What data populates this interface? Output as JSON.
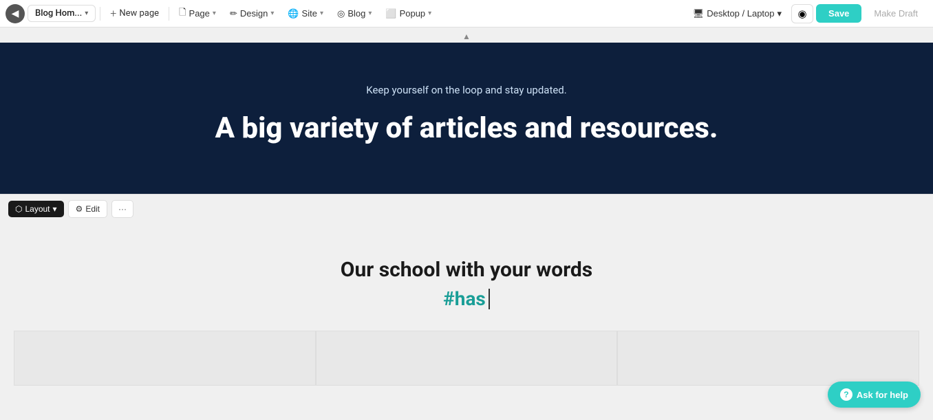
{
  "toolbar": {
    "back_icon": "◀",
    "page_name": "Blog Hom...",
    "page_chevron": "▾",
    "new_page_icon": "+",
    "new_page_label": "New page",
    "page_menu": {
      "icon": "🗋",
      "label": "Page",
      "chevron": "▾"
    },
    "design_menu": {
      "icon": "✏",
      "label": "Design",
      "chevron": "▾"
    },
    "site_menu": {
      "icon": "🌐",
      "label": "Site",
      "chevron": "▾"
    },
    "blog_menu": {
      "icon": "◎",
      "label": "Blog",
      "chevron": "▾"
    },
    "popup_menu": {
      "icon": "⬜",
      "label": "Popup",
      "chevron": "▾"
    },
    "preview_label": "Desktop / Laptop",
    "preview_chevron": "▾",
    "preview_icon": "🖥",
    "eye_icon": "◉",
    "save_label": "Save",
    "draft_label": "Make Draft"
  },
  "section_controls": {
    "layout_label": "Layout",
    "layout_icon": "⬡",
    "layout_chevron": "▾",
    "edit_icon": "⚙",
    "edit_label": "Edit",
    "more_icon": "···"
  },
  "hero": {
    "subtitle": "Keep yourself on the loop and stay updated.",
    "title": "A big variety of articles and resources."
  },
  "content": {
    "title": "Our school with your words",
    "hashtag": "#has",
    "cursor": "|"
  },
  "help": {
    "icon": "?",
    "label": "Ask for help"
  }
}
